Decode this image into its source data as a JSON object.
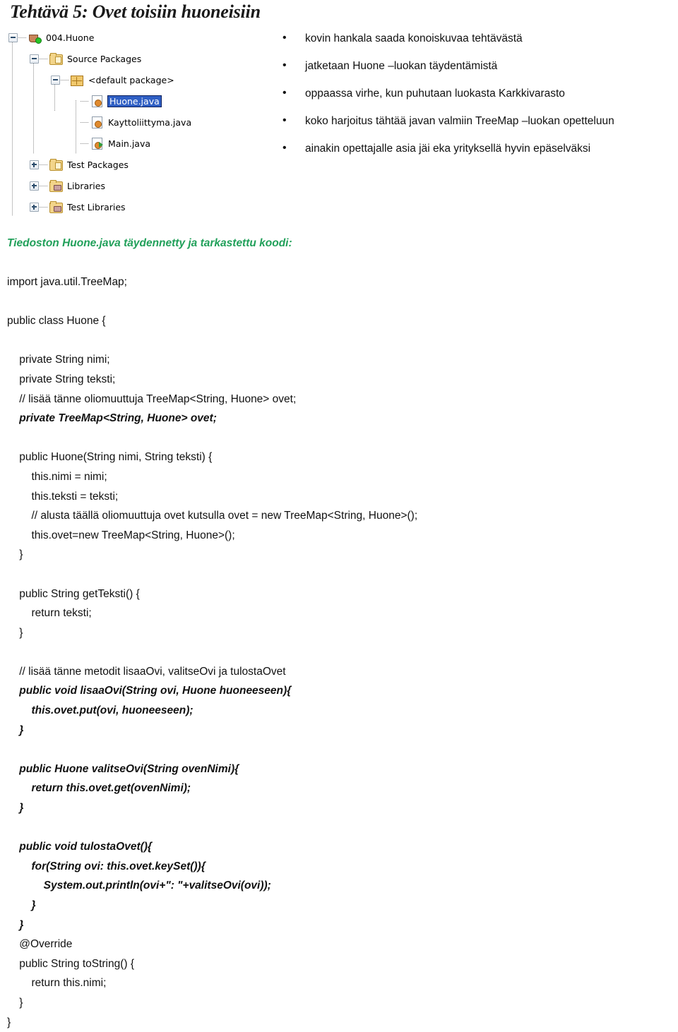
{
  "title": "Tehtävä 5: Ovet toisiin huoneisiin",
  "project_tree": {
    "name": "netbeans-project-explorer",
    "selection_color": "#2f5fc4",
    "nodes": [
      {
        "label": "004.Huone",
        "icon": "project-icon",
        "toggle": "minus",
        "depth": 0,
        "selected": false
      },
      {
        "label": "Source Packages",
        "icon": "folder-icon",
        "toggle": "minus",
        "depth": 1,
        "selected": false
      },
      {
        "label": "<default package>",
        "icon": "package-icon",
        "toggle": "minus",
        "depth": 2,
        "selected": false
      },
      {
        "label": "Huone.java",
        "icon": "java-file-icon",
        "toggle": "none",
        "depth": 3,
        "selected": true
      },
      {
        "label": "Kayttoliittyma.java",
        "icon": "java-file-icon",
        "toggle": "none",
        "depth": 3,
        "selected": false
      },
      {
        "label": "Main.java",
        "icon": "java-main-icon",
        "toggle": "none",
        "depth": 3,
        "selected": false
      },
      {
        "label": "Test Packages",
        "icon": "folder-icon",
        "toggle": "plus",
        "depth": 1,
        "selected": false
      },
      {
        "label": "Libraries",
        "icon": "library-icon",
        "toggle": "plus",
        "depth": 1,
        "selected": false
      },
      {
        "label": "Test Libraries",
        "icon": "library-icon",
        "toggle": "plus",
        "depth": 1,
        "selected": false
      }
    ]
  },
  "bullets": [
    "kovin hankala saada konoiskuvaa tehtävästä",
    "jatketaan Huone –luokan täydentämistä",
    "oppaassa virhe, kun puhutaan luokasta Karkkivarasto",
    "koko harjoitus tähtää javan valmiin TreeMap –luokan opetteluun",
    "ainakin opettajalle asia jäi eka yrityksellä hyvin epäselväksi"
  ],
  "code_heading": "Tiedoston Huone.java täydennetty ja tarkastettu koodi:",
  "code_heading_color": "#21a05a",
  "code_lines": [
    {
      "text": "import java.util.TreeMap;",
      "bold_italic": false
    },
    {
      "text": "",
      "bold_italic": false
    },
    {
      "text": "public class Huone {",
      "bold_italic": false
    },
    {
      "text": "",
      "bold_italic": false
    },
    {
      "text": "    private String nimi;",
      "bold_italic": false
    },
    {
      "text": "    private String teksti;",
      "bold_italic": false
    },
    {
      "text": "    // lisää tänne oliomuuttuja TreeMap<String, Huone> ovet;",
      "bold_italic": false
    },
    {
      "text": "    private TreeMap<String, Huone> ovet;",
      "bold_italic": true
    },
    {
      "text": "",
      "bold_italic": false
    },
    {
      "text": "    public Huone(String nimi, String teksti) {",
      "bold_italic": false
    },
    {
      "text": "        this.nimi = nimi;",
      "bold_italic": false
    },
    {
      "text": "        this.teksti = teksti;",
      "bold_italic": false
    },
    {
      "text": "        // alusta täällä oliomuuttuja ovet kutsulla ovet = new TreeMap<String, Huone>();",
      "bold_italic": false
    },
    {
      "text": "        this.ovet=new TreeMap<String, Huone>();",
      "bold_italic": false
    },
    {
      "text": "    }",
      "bold_italic": false
    },
    {
      "text": "",
      "bold_italic": false
    },
    {
      "text": "    public String getTeksti() {",
      "bold_italic": false
    },
    {
      "text": "        return teksti;",
      "bold_italic": false
    },
    {
      "text": "    }",
      "bold_italic": false
    },
    {
      "text": "",
      "bold_italic": false
    },
    {
      "text": "    // lisää tänne metodit lisaaOvi, valitseOvi ja tulostaOvet",
      "bold_italic": false
    },
    {
      "text": "    public void lisaaOvi(String ovi, Huone huoneeseen){",
      "bold_italic": true
    },
    {
      "text": "        this.ovet.put(ovi, huoneeseen);",
      "bold_italic": true
    },
    {
      "text": "    }",
      "bold_italic": true
    },
    {
      "text": "",
      "bold_italic": false
    },
    {
      "text": "    public Huone valitseOvi(String ovenNimi){",
      "bold_italic": true
    },
    {
      "text": "        return this.ovet.get(ovenNimi);",
      "bold_italic": true
    },
    {
      "text": "    }",
      "bold_italic": true
    },
    {
      "text": "",
      "bold_italic": false
    },
    {
      "text": "    public void tulostaOvet(){",
      "bold_italic": true
    },
    {
      "text": "        for(String ovi: this.ovet.keySet()){",
      "bold_italic": true
    },
    {
      "text": "            System.out.println(ovi+\": \"+valitseOvi(ovi));",
      "bold_italic": true
    },
    {
      "text": "        }",
      "bold_italic": true
    },
    {
      "text": "    }",
      "bold_italic": true
    },
    {
      "text": "    @Override",
      "bold_italic": false
    },
    {
      "text": "    public String toString() {",
      "bold_italic": false
    },
    {
      "text": "        return this.nimi;",
      "bold_italic": false
    },
    {
      "text": "    }",
      "bold_italic": false
    },
    {
      "text": "}",
      "bold_italic": false
    }
  ]
}
